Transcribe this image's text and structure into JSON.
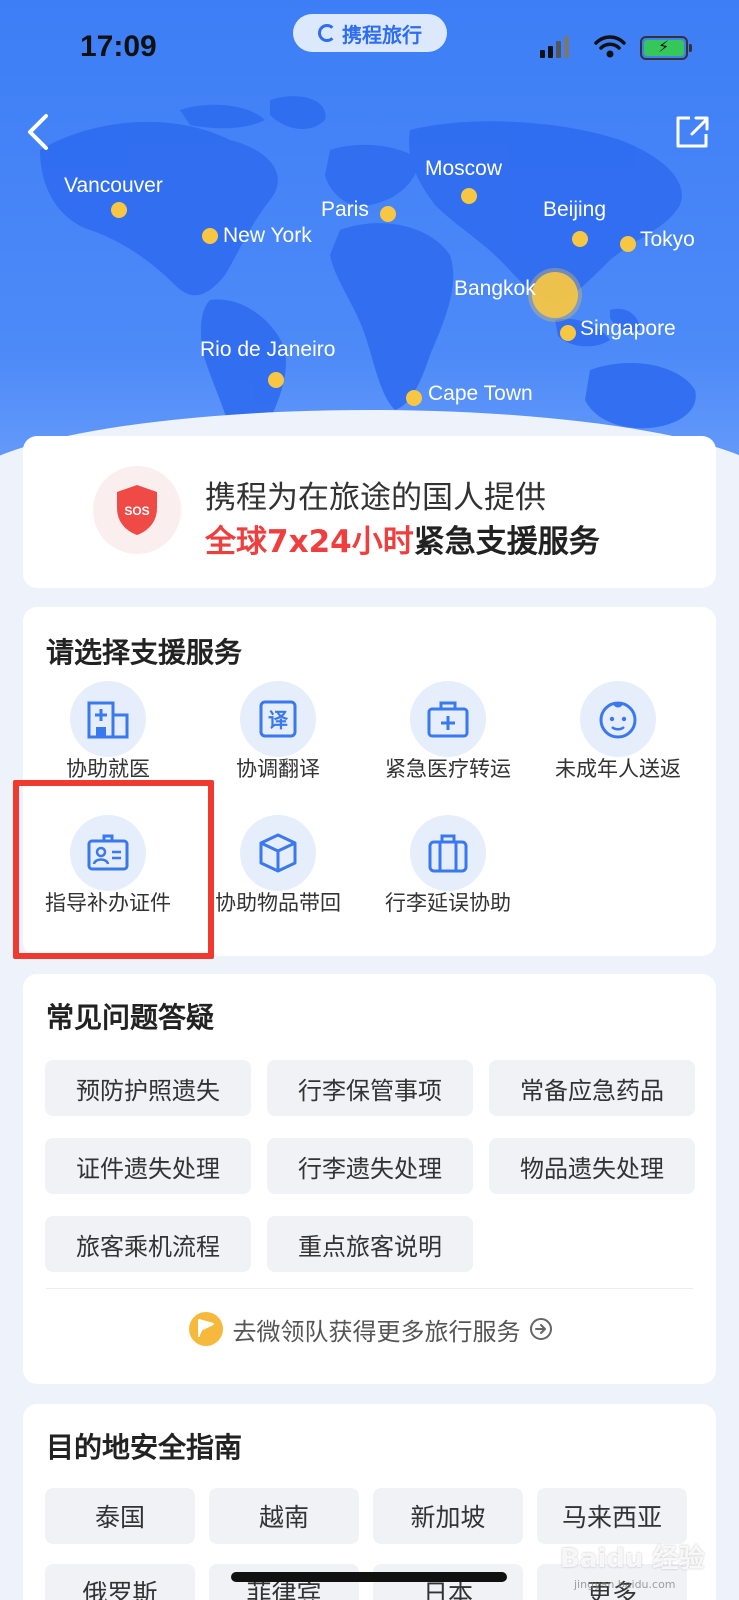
{
  "status_bar": {
    "time": "17:09",
    "app_name": "携程旅行"
  },
  "header": {
    "back_icon": "chevron-left-icon",
    "share_icon": "share-icon"
  },
  "map": {
    "cities": [
      "Vancouver",
      "New York",
      "Paris",
      "Moscow",
      "Beijing",
      "Tokyo",
      "Bangkok",
      "Singapore",
      "Rio de Janeiro",
      "Cape Town"
    ],
    "dot_color": "#f7c744"
  },
  "sos": {
    "badge": "SOS",
    "line1": "携程为在旅途的国人提供",
    "line2_highlight": "全球7x24小时",
    "line2_rest": "紧急支援服务",
    "highlight_color": "#ef3e3e"
  },
  "services": {
    "title": "请选择支援服务",
    "items": [
      {
        "label": "协助就医",
        "icon": "hospital-icon"
      },
      {
        "label": "协调翻译",
        "icon": "translate-icon"
      },
      {
        "label": "紧急医疗转运",
        "icon": "medical-kit-icon"
      },
      {
        "label": "未成年人送返",
        "icon": "child-face-icon"
      },
      {
        "label": "指导补办证件",
        "icon": "id-card-icon"
      },
      {
        "label": "协助物品带回",
        "icon": "box-icon"
      },
      {
        "label": "行李延误协助",
        "icon": "luggage-icon"
      }
    ]
  },
  "faq": {
    "title": "常见问题答疑",
    "chips": [
      "预防护照遗失",
      "行李保管事项",
      "常备应急药品",
      "证件遗失处理",
      "行李遗失处理",
      "物品遗失处理",
      "旅客乘机流程",
      "重点旅客说明"
    ],
    "more_link": "去微领队获得更多旅行服务"
  },
  "guide": {
    "title": "目的地安全指南",
    "countries": [
      "泰国",
      "越南",
      "新加坡",
      "马来西亚",
      "俄罗斯",
      "菲律宾",
      "日本",
      "更多"
    ]
  },
  "watermark": {
    "text": "Baidu 经验",
    "sub": "jingyan.baidu.com"
  },
  "colors": {
    "primary": "#3d7ef6",
    "accent_red": "#ef3e3e",
    "highlight_box": "#f03a30"
  }
}
